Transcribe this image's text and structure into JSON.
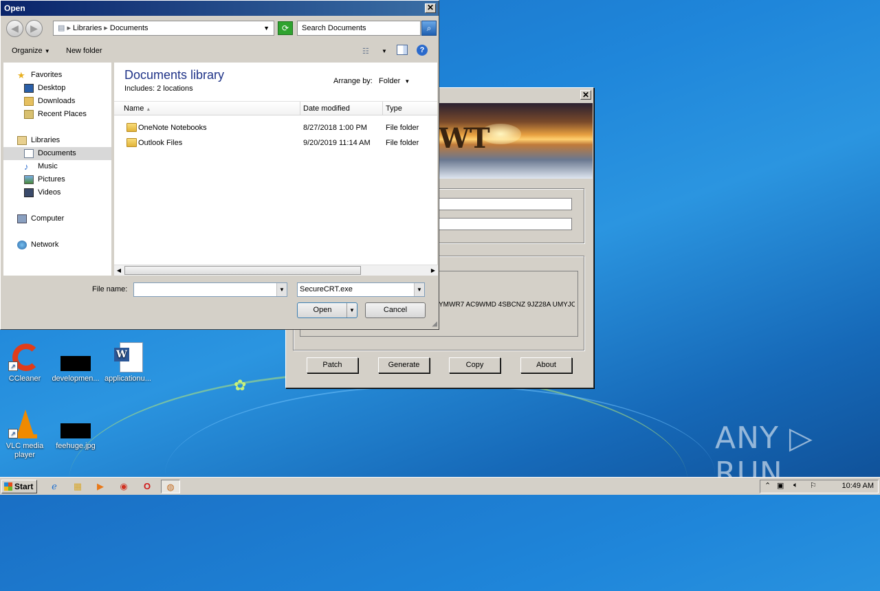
{
  "desktop": {
    "icons": [
      {
        "label": "CCleaner"
      },
      {
        "label": "developmen..."
      },
      {
        "label": "applicationu..."
      },
      {
        "label": "VLC media player"
      },
      {
        "label": "feehuge.jpg"
      }
    ],
    "watermark": "ANY ▷ RUN"
  },
  "keygen": {
    "banner_text": "WT",
    "serial_text": "YMWR7 AC9WMD 4SBCNZ 9JZ28A UMYJC",
    "buttons": [
      "Patch",
      "Generate",
      "Copy",
      "About"
    ]
  },
  "dialog": {
    "title": "Open",
    "close": "✕",
    "address": [
      "Libraries",
      "Documents"
    ],
    "search_placeholder": "Search Documents",
    "commands": {
      "organize": "Organize",
      "new_folder": "New folder"
    },
    "nav": {
      "favorites": "Favorites",
      "desktop": "Desktop",
      "downloads": "Downloads",
      "recent": "Recent Places",
      "libraries": "Libraries",
      "documents": "Documents",
      "music": "Music",
      "pictures": "Pictures",
      "videos": "Videos",
      "computer": "Computer",
      "network": "Network"
    },
    "library_title": "Documents library",
    "library_sub": "Includes:  2 locations",
    "arrange_label": "Arrange by:",
    "arrange_value": "Folder",
    "columns": {
      "name": "Name",
      "date": "Date modified",
      "type": "Type"
    },
    "files": [
      {
        "name": "OneNote Notebooks",
        "date": "8/27/2018 1:00 PM",
        "type": "File folder"
      },
      {
        "name": "Outlook Files",
        "date": "9/20/2019 11:14 AM",
        "type": "File folder"
      }
    ],
    "file_name_label": "File name:",
    "file_name_value": "",
    "file_type_value": "SecureCRT.exe",
    "open_label": "Open",
    "cancel_label": "Cancel"
  },
  "taskbar": {
    "start": "Start",
    "clock": "10:49 AM"
  }
}
